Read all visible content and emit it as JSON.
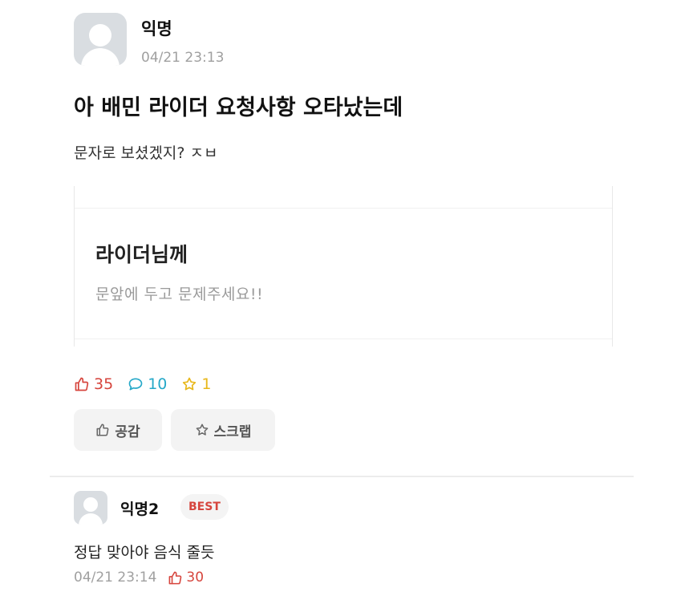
{
  "post": {
    "author": "익명",
    "date": "04/21 23:13",
    "title": "아 배민 라이더 요청사항 오타났는데",
    "body": "문자로 보셨겠지? ㅈㅂ"
  },
  "attachment": {
    "heading": "라이더님께",
    "request": "문앞에 두고 문제주세요!!"
  },
  "stats": {
    "likes": "35",
    "comments": "10",
    "scraps": "1"
  },
  "actions": {
    "like_label": "공감",
    "scrap_label": "스크랩"
  },
  "comment": {
    "author": "익명2",
    "badge": "BEST",
    "text": "정답 맞아야 음식 줄듯",
    "date": "04/21 23:14",
    "likes": "30"
  },
  "colors": {
    "like": "#d6453d",
    "comment": "#25a8c8",
    "scrap": "#e8b71a"
  },
  "icons": {
    "like": "thumbs-up-icon",
    "comment": "speech-bubble-icon",
    "scrap": "star-icon"
  }
}
